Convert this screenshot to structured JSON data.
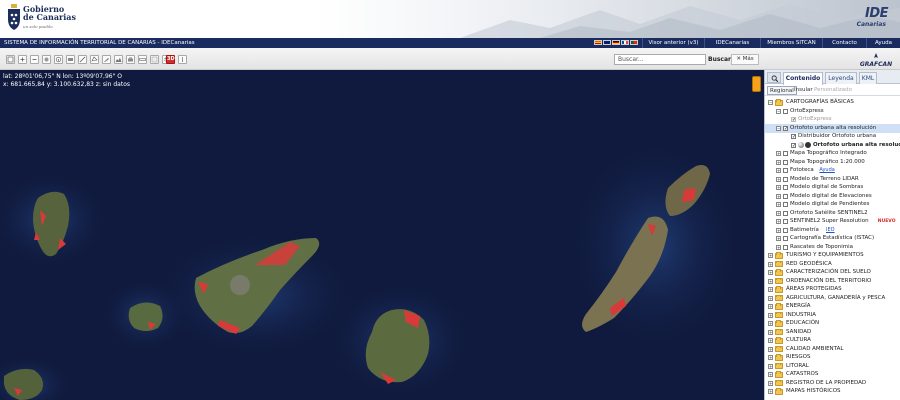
{
  "header": {
    "gov_name_line1": "Gobierno",
    "gov_name_line2": "de Canarias",
    "gov_tagline": "un solo pueblo",
    "ide_logo_line1": "IDE",
    "ide_logo_line2": "Canarias"
  },
  "navbar": {
    "site_title": "SISTEMA DE INFORMACIÓN TERRITORIAL DE CANARIAS - IDECanarias",
    "flags": [
      "es",
      "en",
      "de",
      "fr",
      "pt"
    ],
    "links": [
      "Visor anterior (v3)",
      "IDECanarias",
      "Miembros SITCAN",
      "Contacto",
      "Ayuda"
    ]
  },
  "toolbar": {
    "tool_icons": [
      "zoom-extent-icon",
      "zoom-in-icon",
      "zoom-out-icon",
      "pan-hand-icon",
      "info-icon",
      "identify-icon",
      "draw-line-icon",
      "draw-area-icon",
      "edit-icon",
      "profile-icon",
      "print-icon",
      "measure-icon",
      "blank-icon",
      "layers-icon",
      "3d-icon",
      "swipe-icon"
    ],
    "three_d_label": "3D",
    "search_placeholder": "Buscar...",
    "search_button": "Buscar",
    "more_button": "✕ Más",
    "grafcan_logo": "GRAFCAN"
  },
  "map": {
    "coords_line1": "lat: 28º01'06,75\" N  lon: 13º09'07,96\" O",
    "coords_line2": "x: 681.665,84  y: 3.100.632,83  z: sin datos"
  },
  "panel": {
    "tabs": [
      "Contenido",
      "Leyenda",
      "KML"
    ],
    "subtabs": [
      "Regional",
      "Insular",
      "Personalizado"
    ],
    "tree": [
      {
        "label": "CARTOGRAFÍAS BÁSICAS",
        "level": 0,
        "type": "folder",
        "expand": "-"
      },
      {
        "label": "OrtoExpress",
        "level": 1,
        "type": "check",
        "expand": "-",
        "checked": false
      },
      {
        "label": "OrtoExpress",
        "level": 2,
        "type": "check-disabled",
        "expand": "",
        "checked": true,
        "style": "gray"
      },
      {
        "label": "Ortofoto urbana alta resolución",
        "level": 1,
        "type": "check",
        "expand": "-",
        "checked": true,
        "selected": true
      },
      {
        "label": "Distribuidor Ortofoto urbana",
        "level": 2,
        "type": "check",
        "expand": "",
        "checked": true
      },
      {
        "label": "Ortofoto urbana alta resolución",
        "level": 2,
        "type": "check-icons",
        "expand": "",
        "checked": true,
        "style": "bold"
      },
      {
        "label": "Mapa Topográfico Integrado",
        "level": 1,
        "type": "check",
        "expand": "+",
        "checked": false
      },
      {
        "label": "Mapa Topográfico 1:20.000",
        "level": 1,
        "type": "check",
        "expand": "+",
        "checked": false
      },
      {
        "label": "Fototeca",
        "level": 1,
        "type": "check",
        "expand": "+",
        "checked": false,
        "link": "Ayuda"
      },
      {
        "label": "Modelo de Terreno LIDAR",
        "level": 1,
        "type": "check",
        "expand": "+",
        "checked": false
      },
      {
        "label": "Modelo digital de Sombras",
        "level": 1,
        "type": "check",
        "expand": "+",
        "checked": false
      },
      {
        "label": "Modelo digital de Elevaciones",
        "level": 1,
        "type": "check",
        "expand": "+",
        "checked": false
      },
      {
        "label": "Modelo digital de Pendientes",
        "level": 1,
        "type": "check",
        "expand": "+",
        "checked": false
      },
      {
        "label": "Ortofoto Satélite SENTINEL2",
        "level": 1,
        "type": "check",
        "expand": "+",
        "checked": false
      },
      {
        "label": "SENTINEL2 Super Resolution",
        "level": 1,
        "type": "check",
        "expand": "+",
        "checked": false,
        "badge": "NUEVO"
      },
      {
        "label": "Batimetría",
        "level": 1,
        "type": "check",
        "expand": "+",
        "checked": false,
        "link": "IEO"
      },
      {
        "label": "Cartografía Estadística (ISTAC)",
        "level": 1,
        "type": "check",
        "expand": "+",
        "checked": false
      },
      {
        "label": "Rascates de Toponimia",
        "level": 1,
        "type": "check",
        "expand": "+",
        "checked": false
      },
      {
        "label": "TURISMO Y EQUIPAMIENTOS",
        "level": 0,
        "type": "folder",
        "expand": "+"
      },
      {
        "label": "RED GEODÉSICA",
        "level": 0,
        "type": "folder",
        "expand": "+"
      },
      {
        "label": "CARACTERIZACIÓN DEL SUELO",
        "level": 0,
        "type": "folder",
        "expand": "+"
      },
      {
        "label": "ORDENACIÓN DEL TERRITORIO",
        "level": 0,
        "type": "folder",
        "expand": "+"
      },
      {
        "label": "ÁREAS PROTEGIDAS",
        "level": 0,
        "type": "folder",
        "expand": "+"
      },
      {
        "label": "AGRICULTURA, GANADERÍA y PESCA",
        "level": 0,
        "type": "folder",
        "expand": "+"
      },
      {
        "label": "ENERGÍA",
        "level": 0,
        "type": "folder",
        "expand": "+"
      },
      {
        "label": "INDUSTRIA",
        "level": 0,
        "type": "folder",
        "expand": "+"
      },
      {
        "label": "EDUCACIÓN",
        "level": 0,
        "type": "folder",
        "expand": "+"
      },
      {
        "label": "SANIDAD",
        "level": 0,
        "type": "folder",
        "expand": "+"
      },
      {
        "label": "CULTURA",
        "level": 0,
        "type": "folder",
        "expand": "+"
      },
      {
        "label": "CALIDAD AMBIENTAL",
        "level": 0,
        "type": "folder",
        "expand": "+"
      },
      {
        "label": "RIESGOS",
        "level": 0,
        "type": "folder",
        "expand": "+"
      },
      {
        "label": "LITORAL",
        "level": 0,
        "type": "folder",
        "expand": "+"
      },
      {
        "label": "CATASTROS",
        "level": 0,
        "type": "folder",
        "expand": "+"
      },
      {
        "label": "REGISTRO DE LA PROPIEDAD",
        "level": 0,
        "type": "folder",
        "expand": "+"
      },
      {
        "label": "MAPAS HISTÓRICOS",
        "level": 0,
        "type": "folder",
        "expand": "+"
      }
    ]
  },
  "colors": {
    "nav_bg": "#1a2b60",
    "ocean": "#101a3e",
    "urban_highlight": "#d83a3a",
    "selected_row": "#cfe0f6"
  }
}
